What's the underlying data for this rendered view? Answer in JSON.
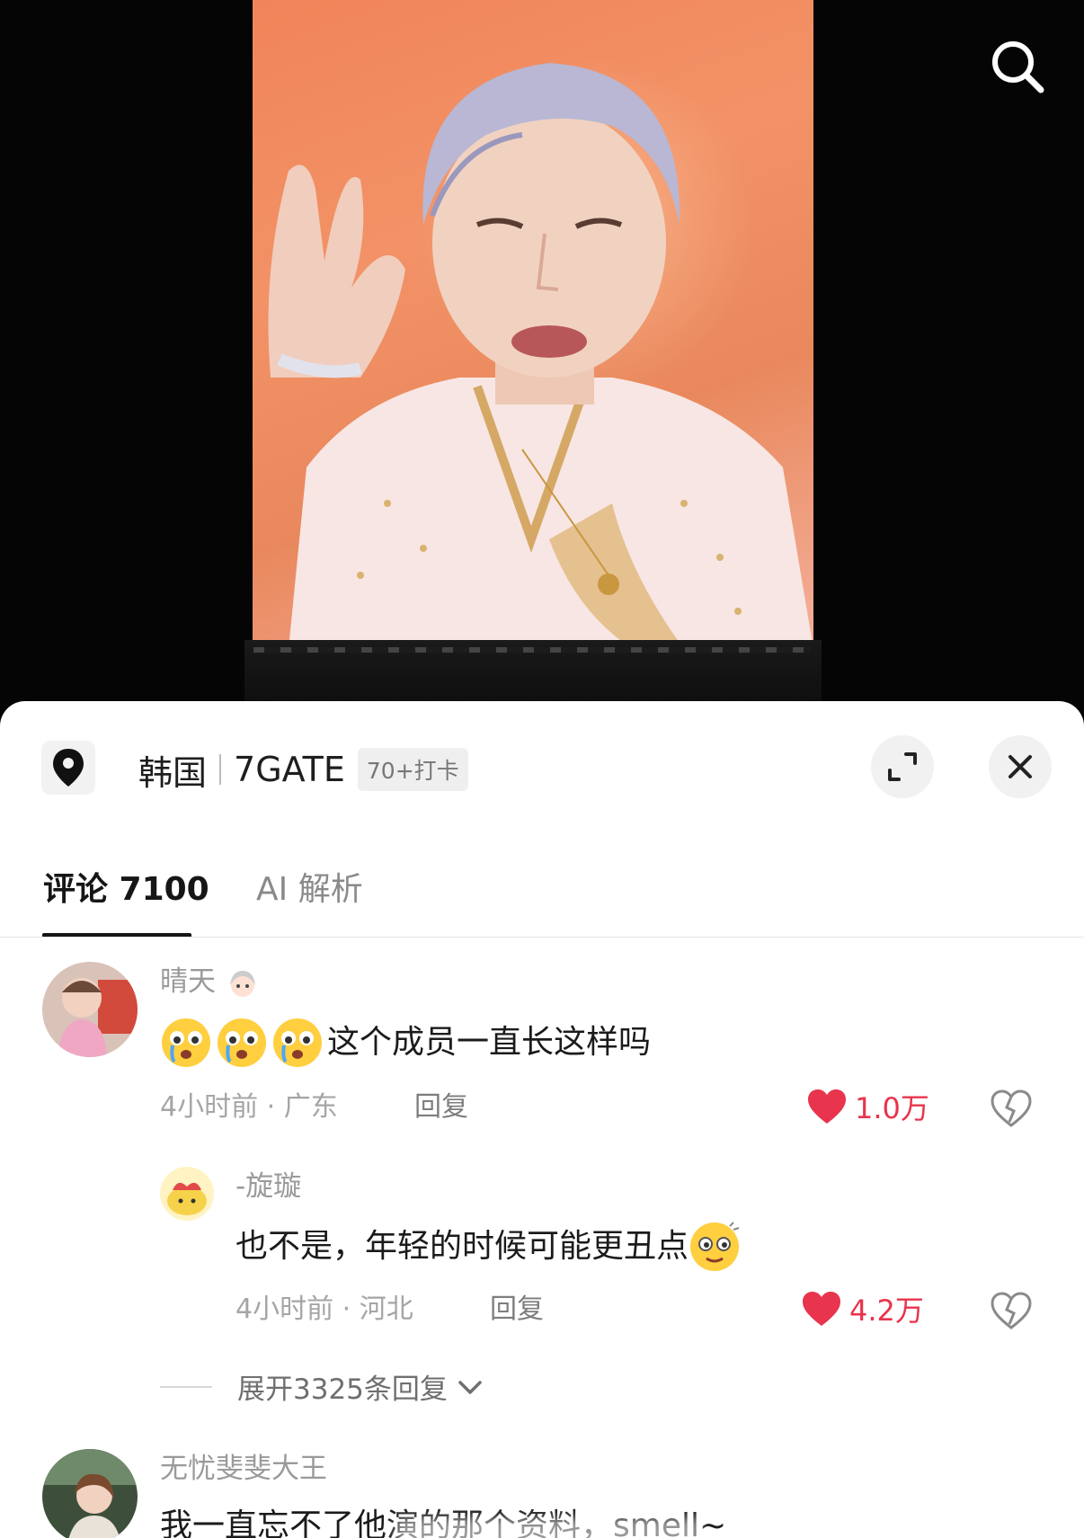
{
  "header": {
    "search_icon": "search-icon"
  },
  "location": {
    "icon": "location-pin-icon",
    "country": "韩国",
    "place": "7GATE",
    "checkins": "70+打卡"
  },
  "tabs": [
    {
      "label": "评论 7100"
    },
    {
      "label": "AI 解析"
    }
  ],
  "comments": [
    {
      "user": "晴天",
      "text": "这个成员一直长这样吗",
      "emoji_prefix_count": 3,
      "time": "4小时前",
      "region": "广东",
      "reply_label": "回复",
      "likes": "1.0万",
      "replies": [
        {
          "user": "-旋璇",
          "text": "也不是，年轻的时候可能更丑点",
          "time": "4小时前",
          "region": "河北",
          "reply_label": "回复",
          "likes": "4.2万"
        }
      ],
      "expand_label": "展开3325条回复"
    },
    {
      "user": "无忧斐斐大王",
      "text": "我一直忘不了他演的那个资料，smell~"
    }
  ],
  "colors": {
    "like": "#e8344d",
    "stage": "#f1845a"
  }
}
